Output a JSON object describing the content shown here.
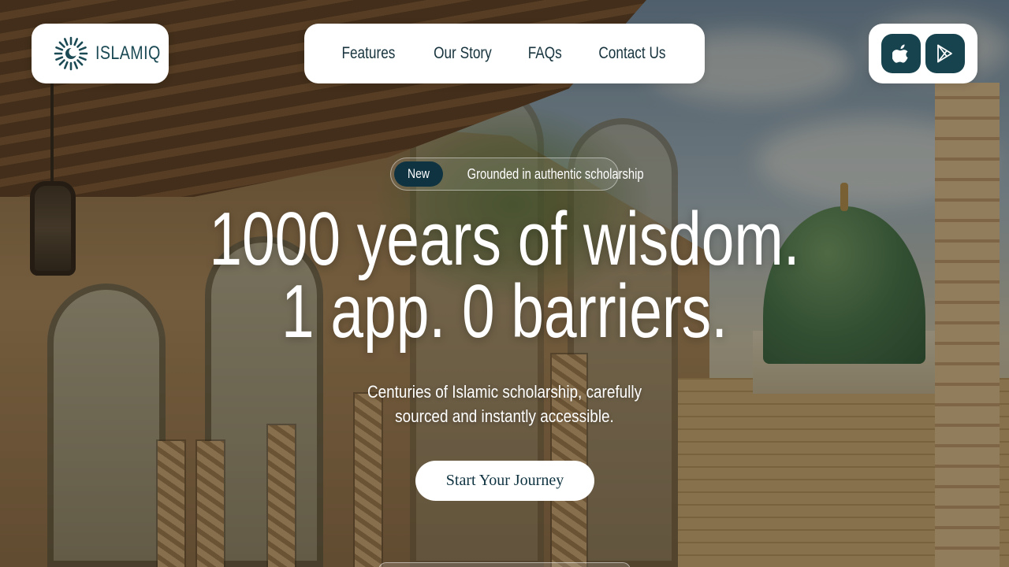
{
  "brand": {
    "name": "ISLAMIQ",
    "logo_icon": "starburst-crescent-logo",
    "accent_color": "#17434e"
  },
  "nav": {
    "items": [
      {
        "label": "Features"
      },
      {
        "label": "Our Story"
      },
      {
        "label": "FAQs"
      },
      {
        "label": "Contact Us"
      }
    ]
  },
  "stores": {
    "apple_icon": "apple-icon",
    "google_play_icon": "google-play-icon"
  },
  "hero": {
    "badge_tag": "New",
    "badge_text": "Grounded in authentic scholarship",
    "headline_line1": "1000 years of wisdom.",
    "headline_line2": "1 app. 0 barriers.",
    "subhead_line1": "Centuries of Islamic scholarship, carefully",
    "subhead_line2": "sourced and instantly accessible.",
    "cta_label": "Start Your Journey"
  }
}
